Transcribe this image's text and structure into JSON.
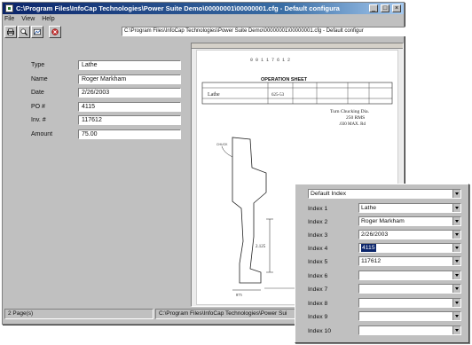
{
  "window": {
    "title": "C:\\Program Files\\InfoCap Technologies\\Power Suite Demo\\00000001\\00000001.cfg - Default configura",
    "controls": {
      "minimize": "_",
      "maximize": "□",
      "close": "×"
    }
  },
  "menu": [
    "File",
    "View",
    "Help"
  ],
  "toolbar": {
    "buttons": [
      "print-icon",
      "scan-icon",
      "image-icon",
      "close-document-icon"
    ],
    "path": "C:\\Program Files\\InfoCap Technologies\\Power Suite Demo\\00000001\\00000001.cfg - Default configur"
  },
  "form": [
    {
      "label": "Type",
      "value": "Lathe"
    },
    {
      "label": "Name",
      "value": "Roger Markham"
    },
    {
      "label": "Date",
      "value": "2/26/2003"
    },
    {
      "label": "PO #",
      "value": "4115"
    },
    {
      "label": "Inv. #",
      "value": "117612"
    },
    {
      "label": "Amount",
      "value": "75.00"
    }
  ],
  "document": {
    "doc_number": "0 0 1 1 7 6 1 2",
    "heading": "OPERATION SHEET",
    "machine": "Lathe",
    "part_no": "625-53",
    "notes": [
      "Turn Chucking Dia.",
      "250 RMS",
      ".030 MAX. Rd"
    ],
    "dims": [
      "2.125",
      "875"
    ]
  },
  "status": {
    "pages": "2 Page(s)",
    "path": "C:\\Program Files\\InfoCap Technologies\\Power Sui"
  },
  "index_popup": {
    "selector": "Default Index",
    "rows": [
      {
        "label": "Index 1",
        "value": "Lathe"
      },
      {
        "label": "Index 2",
        "value": "Roger Markham"
      },
      {
        "label": "Index 3",
        "value": "2/26/2003"
      },
      {
        "label": "Index 4",
        "value": "4115",
        "selected": true
      },
      {
        "label": "Index 5",
        "value": "117612"
      },
      {
        "label": "Index 6",
        "value": ""
      },
      {
        "label": "Index 7",
        "value": ""
      },
      {
        "label": "Index 8",
        "value": ""
      },
      {
        "label": "Index 9",
        "value": ""
      },
      {
        "label": "Index 10",
        "value": ""
      }
    ]
  }
}
